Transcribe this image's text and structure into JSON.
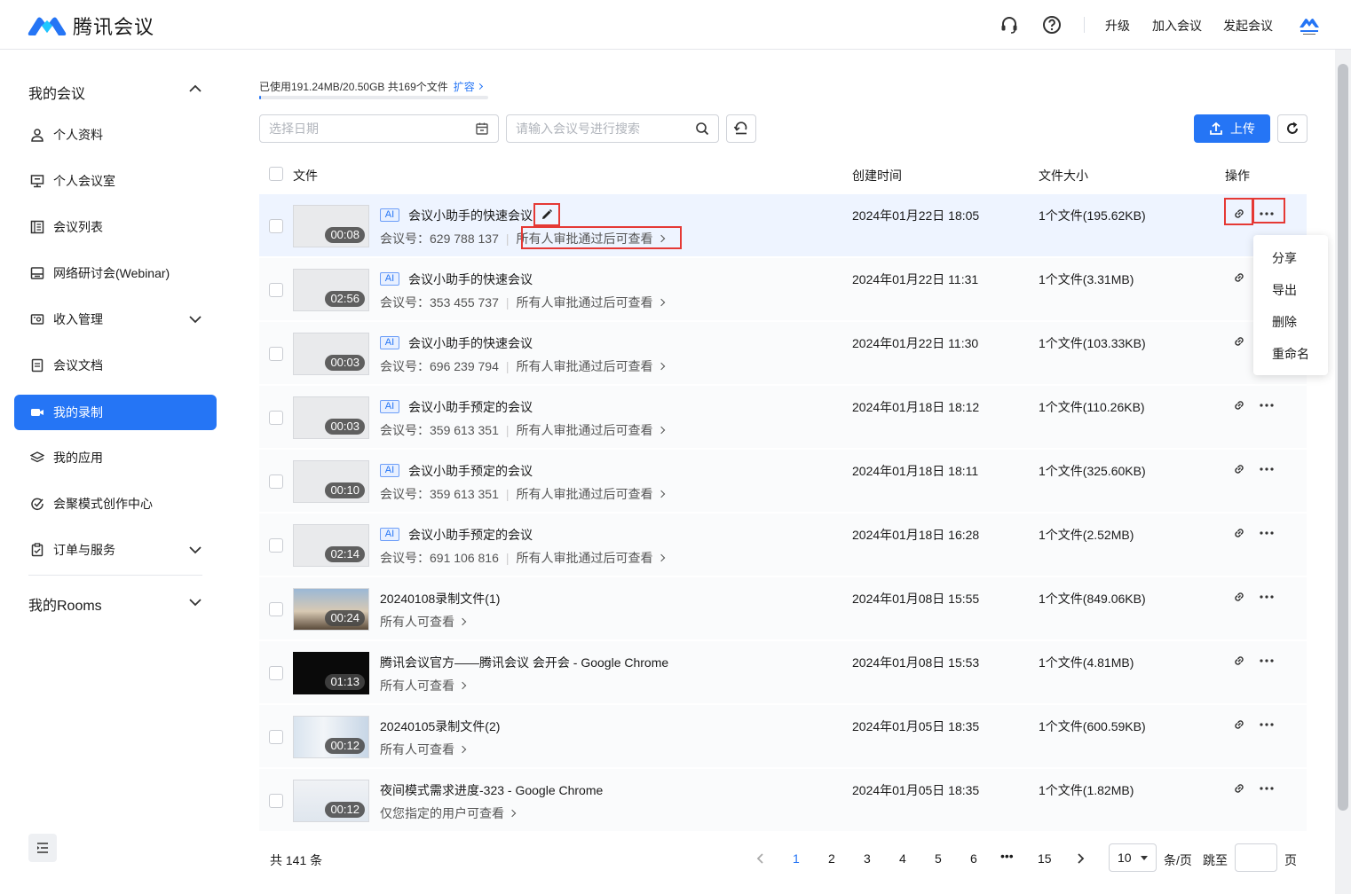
{
  "app": {
    "name": "腾讯会议"
  },
  "header": {
    "links": [
      "升级",
      "加入会议",
      "发起会议"
    ],
    "icons": [
      "headset-icon",
      "help-icon",
      "avatar-logo"
    ],
    "brand_color": "#2575f5"
  },
  "sidebar": {
    "group_title": "我的会议",
    "items": [
      {
        "label": "个人资料",
        "icon": "user-icon"
      },
      {
        "label": "个人会议室",
        "icon": "monitor-icon"
      },
      {
        "label": "会议列表",
        "icon": "list-icon"
      },
      {
        "label": "网络研讨会(Webinar)",
        "icon": "webinar-icon"
      },
      {
        "label": "收入管理",
        "icon": "income-icon",
        "expandable": true
      },
      {
        "label": "会议文档",
        "icon": "document-icon"
      },
      {
        "label": "我的录制",
        "icon": "record-icon",
        "active": true
      },
      {
        "label": "我的应用",
        "icon": "apps-icon"
      },
      {
        "label": "会聚模式创作中心",
        "icon": "creative-icon"
      },
      {
        "label": "订单与服务",
        "icon": "order-icon",
        "expandable": true
      }
    ],
    "rooms_title": "我的Rooms"
  },
  "toolbar": {
    "usage_text": "已使用191.24MB/20.50GB  共169个文件",
    "expand_label": "扩容",
    "usage_fraction": 0.009,
    "date_placeholder": "选择日期",
    "search_placeholder": "请输入会议号进行搜索",
    "upload_label": "上传"
  },
  "table": {
    "headers": {
      "file": "文件",
      "created": "创建时间",
      "size": "文件大小",
      "ops": "操作"
    },
    "rows": [
      {
        "title": "会议小助手的快速会议",
        "ai": "AI",
        "meeting_label": "会议号：",
        "meeting_id": "629 788 137",
        "perm": "所有人审批通过后可查看",
        "time": "2024年01月22日 18:05",
        "size": "1个文件(195.62KB)",
        "duration": "00:08",
        "thumb": "gray"
      },
      {
        "title": "会议小助手的快速会议",
        "ai": "AI",
        "meeting_label": "会议号：",
        "meeting_id": "353 455 737",
        "perm": "所有人审批通过后可查看",
        "time": "2024年01月22日 11:31",
        "size": "1个文件(3.31MB)",
        "duration": "02:56",
        "thumb": "gray"
      },
      {
        "title": "会议小助手的快速会议",
        "ai": "AI",
        "meeting_label": "会议号：",
        "meeting_id": "696 239 794",
        "perm": "所有人审批通过后可查看",
        "time": "2024年01月22日 11:30",
        "size": "1个文件(103.33KB)",
        "duration": "00:03",
        "thumb": "gray"
      },
      {
        "title": "会议小助手预定的会议",
        "ai": "AI",
        "meeting_label": "会议号：",
        "meeting_id": "359 613 351",
        "perm": "所有人审批通过后可查看",
        "time": "2024年01月18日 18:12",
        "size": "1个文件(110.26KB)",
        "duration": "00:03",
        "thumb": "gray"
      },
      {
        "title": "会议小助手预定的会议",
        "ai": "AI",
        "meeting_label": "会议号：",
        "meeting_id": "359 613 351",
        "perm": "所有人审批通过后可查看",
        "time": "2024年01月18日 18:11",
        "size": "1个文件(325.60KB)",
        "duration": "00:10",
        "thumb": "gray"
      },
      {
        "title": "会议小助手预定的会议",
        "ai": "AI",
        "meeting_label": "会议号：",
        "meeting_id": "691 106 816",
        "perm": "所有人审批通过后可查看",
        "time": "2024年01月18日 16:28",
        "size": "1个文件(2.52MB)",
        "duration": "02:14",
        "thumb": "gray"
      },
      {
        "title": "20240108录制文件(1)",
        "perm": "所有人可查看",
        "time": "2024年01月08日 15:55",
        "size": "1个文件(849.06KB)",
        "duration": "00:24",
        "thumb": "beach"
      },
      {
        "title": "腾讯会议官方——腾讯会议 会开会 - Google Chrome",
        "perm": "所有人可查看",
        "time": "2024年01月08日 15:53",
        "size": "1个文件(4.81MB)",
        "duration": "01:13",
        "thumb": "dark"
      },
      {
        "title": "20240105录制文件(2)",
        "perm": "所有人可查看",
        "time": "2024年01月05日 18:35",
        "size": "1个文件(600.59KB)",
        "duration": "00:12",
        "thumb": "office"
      },
      {
        "title": "夜间模式需求进度-323 - Google Chrome",
        "perm": "仅您指定的用户可查看",
        "time": "2024年01月05日 18:35",
        "size": "1个文件(1.82MB)",
        "duration": "00:12",
        "thumb": "screen"
      }
    ]
  },
  "menu": {
    "items": [
      "分享",
      "导出",
      "删除",
      "重命名"
    ]
  },
  "pagination": {
    "total_text": "共  141  条",
    "pages": [
      "1",
      "2",
      "3",
      "4",
      "5",
      "6",
      "•••",
      "15"
    ],
    "current": "1",
    "page_size": "10",
    "per_page_label": "条/页",
    "jump_label": "跳至",
    "page_suffix": "页"
  }
}
